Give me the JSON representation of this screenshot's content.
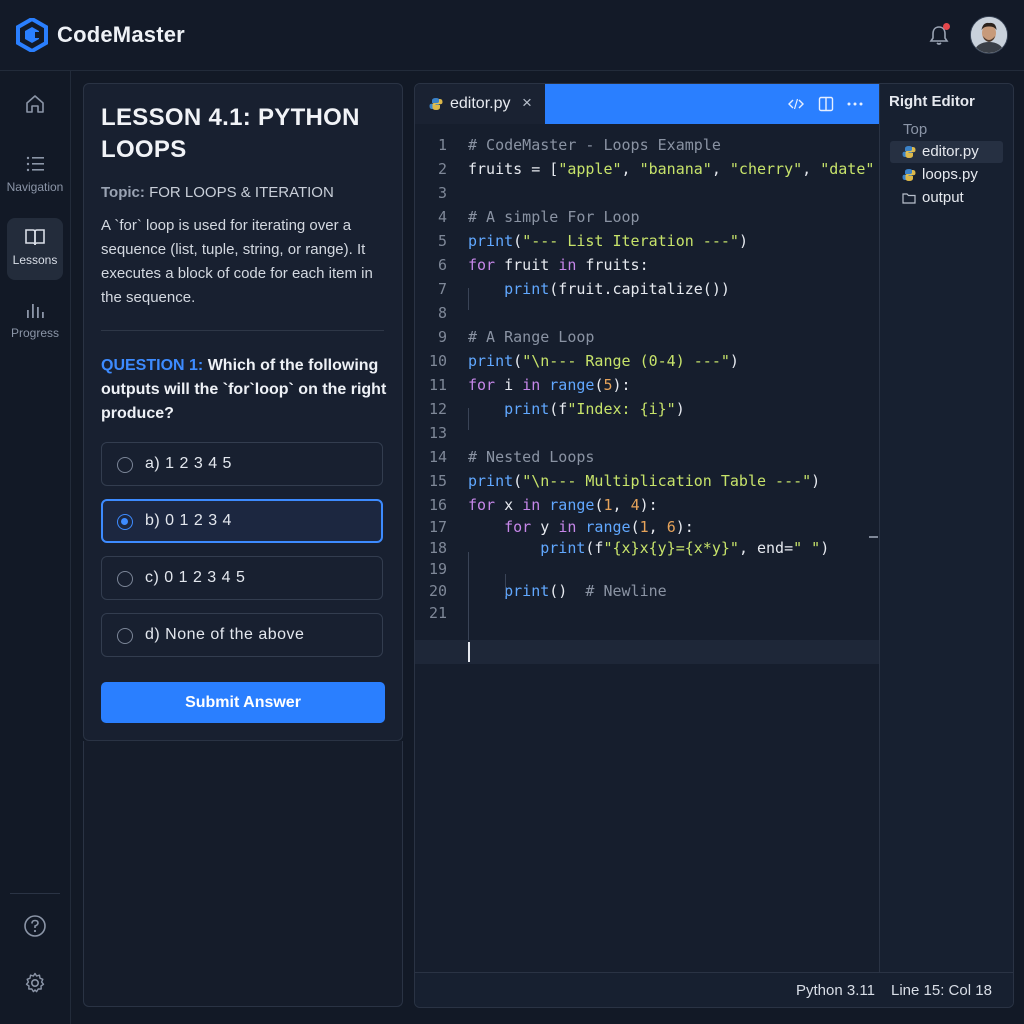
{
  "app": {
    "brand": "CodeMaster"
  },
  "header": {
    "notification_icon": "bell-icon",
    "avatar_icon": "user-avatar"
  },
  "rail": {
    "items": [
      {
        "label": "",
        "icon": "home-icon"
      },
      {
        "label": "Navigation",
        "icon": "list-icon"
      },
      {
        "label": "Lessons",
        "icon": "book-icon",
        "active": true
      },
      {
        "label": "Progress",
        "icon": "bar-chart-icon"
      }
    ],
    "bottom": [
      {
        "icon": "help-icon"
      },
      {
        "icon": "gear-icon"
      }
    ]
  },
  "lesson": {
    "title": "LESSON 4.1: PYTHON LOOPS",
    "topic_label": "Topic:",
    "topic_value": "FOR LOOPS & ITERATION",
    "description": "A `for` loop is used for iterating over a sequence (list, tuple, string, or range). It executes a block of code for each item in the sequence.",
    "question_label": "QUESTION 1:",
    "question_text": "Which of the following outputs will the `for`loop` on the right produce?",
    "options": [
      {
        "label": "a) 1 2 3 4 5",
        "selected": false
      },
      {
        "label": "b) 0 1 2 3 4",
        "selected": true
      },
      {
        "label": "c) 0 1 2 3 4 5",
        "selected": false
      },
      {
        "label": "d) None of the above",
        "selected": false
      }
    ],
    "submit_label": "Submit Answer"
  },
  "editor": {
    "tab_label": "editor.py",
    "tab_close": "×",
    "toolbar_icons": [
      "code-icon",
      "split-view-icon",
      "more-icon"
    ],
    "code_lines": [
      {
        "n": "1",
        "segs": [
          [
            "c-com",
            "# CodeMaster - Loops Example"
          ]
        ]
      },
      {
        "n": "2",
        "segs": [
          [
            "",
            "fruits = ["
          ],
          [
            "c-str",
            "\"apple\""
          ],
          [
            "",
            ", "
          ],
          [
            "c-str",
            "\"banana\""
          ],
          [
            "",
            ", "
          ],
          [
            "c-str",
            "\"cherry\""
          ],
          [
            "",
            ", "
          ],
          [
            "c-str",
            "\"date\""
          ]
        ]
      },
      {
        "n": "3",
        "segs": []
      },
      {
        "n": "4",
        "segs": [
          [
            "c-com",
            "# A simple For Loop"
          ]
        ]
      },
      {
        "n": "5",
        "segs": [
          [
            "c-fn",
            "print"
          ],
          [
            "",
            "("
          ],
          [
            "c-str",
            "\"--- List Iteration ---\""
          ],
          [
            "",
            ")"
          ]
        ]
      },
      {
        "n": "6",
        "segs": [
          [
            "c-kw",
            "for"
          ],
          [
            "",
            " fruit "
          ],
          [
            "c-kw",
            "in"
          ],
          [
            "",
            " fruits:"
          ]
        ]
      },
      {
        "n": "7",
        "segs": [
          [
            "",
            "    "
          ],
          [
            "c-fn",
            "print"
          ],
          [
            "",
            "(fruit.capitalize())"
          ]
        ]
      },
      {
        "n": "8",
        "segs": []
      },
      {
        "n": "9",
        "segs": [
          [
            "c-com",
            "# A Range Loop"
          ]
        ]
      },
      {
        "n": "10",
        "segs": [
          [
            "c-fn",
            "print"
          ],
          [
            "",
            "("
          ],
          [
            "c-str",
            "\"\\n--- Range (0-4) ---\""
          ],
          [
            "",
            ")"
          ]
        ]
      },
      {
        "n": "11",
        "segs": [
          [
            "c-kw",
            "for"
          ],
          [
            "",
            " i "
          ],
          [
            "c-kw",
            "in"
          ],
          [
            "",
            " "
          ],
          [
            "c-fn",
            "range"
          ],
          [
            "",
            "("
          ],
          [
            "c-num",
            "5"
          ],
          [
            "",
            "):"
          ]
        ]
      },
      {
        "n": "12",
        "segs": [
          [
            "",
            "    "
          ],
          [
            "c-fn",
            "print"
          ],
          [
            "",
            "(f"
          ],
          [
            "c-str",
            "\"Index: {i}\""
          ],
          [
            "",
            ")"
          ]
        ]
      },
      {
        "n": "13",
        "segs": []
      },
      {
        "n": "14",
        "segs": [
          [
            "c-com",
            "# Nested Loops"
          ]
        ]
      },
      {
        "n": "15",
        "segs": [
          [
            "c-fn",
            "print"
          ],
          [
            "",
            "("
          ],
          [
            "c-str",
            "\"\\n--- Multiplication Table ---\""
          ],
          [
            "",
            ")"
          ]
        ]
      },
      {
        "n": "16",
        "segs": [
          [
            "c-kw",
            "for"
          ],
          [
            "",
            " x "
          ],
          [
            "c-kw",
            "in"
          ],
          [
            "",
            " "
          ],
          [
            "c-fn",
            "range"
          ],
          [
            "",
            "("
          ],
          [
            "c-num",
            "1"
          ],
          [
            "",
            ", "
          ],
          [
            "c-num",
            "4"
          ],
          [
            "",
            "):"
          ]
        ]
      },
      {
        "n": "17",
        "segs": [
          [
            "",
            "    "
          ],
          [
            "c-kw",
            "for"
          ],
          [
            "",
            " y "
          ],
          [
            "c-kw",
            "in"
          ],
          [
            "",
            " "
          ],
          [
            "c-fn",
            "range"
          ],
          [
            "",
            "("
          ],
          [
            "c-num",
            "1"
          ],
          [
            "",
            ", "
          ],
          [
            "c-num",
            "6"
          ],
          [
            "",
            "):"
          ]
        ]
      },
      {
        "n": "18",
        "segs": [
          [
            "",
            "        "
          ],
          [
            "c-fn",
            "print"
          ],
          [
            "",
            "(f"
          ],
          [
            "c-str",
            "\"{x}x{y}={x*y}\""
          ],
          [
            "",
            ", end="
          ],
          [
            "c-str",
            "\" \""
          ],
          [
            "",
            ")"
          ]
        ]
      },
      {
        "n": "19",
        "segs": []
      },
      {
        "n": "20",
        "segs": [
          [
            "",
            "    "
          ],
          [
            "c-fn",
            "print"
          ],
          [
            "",
            "()  "
          ],
          [
            "c-com",
            "# Newline"
          ]
        ]
      },
      {
        "n": "21",
        "segs": []
      }
    ]
  },
  "explorer": {
    "title": "Right Editor",
    "top_label": "Top",
    "items": [
      {
        "label": "editor.py",
        "icon": "python-file-icon",
        "selected": true
      },
      {
        "label": "loops.py",
        "icon": "python-file-icon",
        "selected": false
      },
      {
        "label": "output",
        "icon": "folder-icon",
        "selected": false
      }
    ]
  },
  "status": {
    "language": "Python 3.11",
    "position": "Line 15: Col 18"
  },
  "colors": {
    "accent": "#2a7fff",
    "background": "#121926",
    "panel": "#182030"
  }
}
